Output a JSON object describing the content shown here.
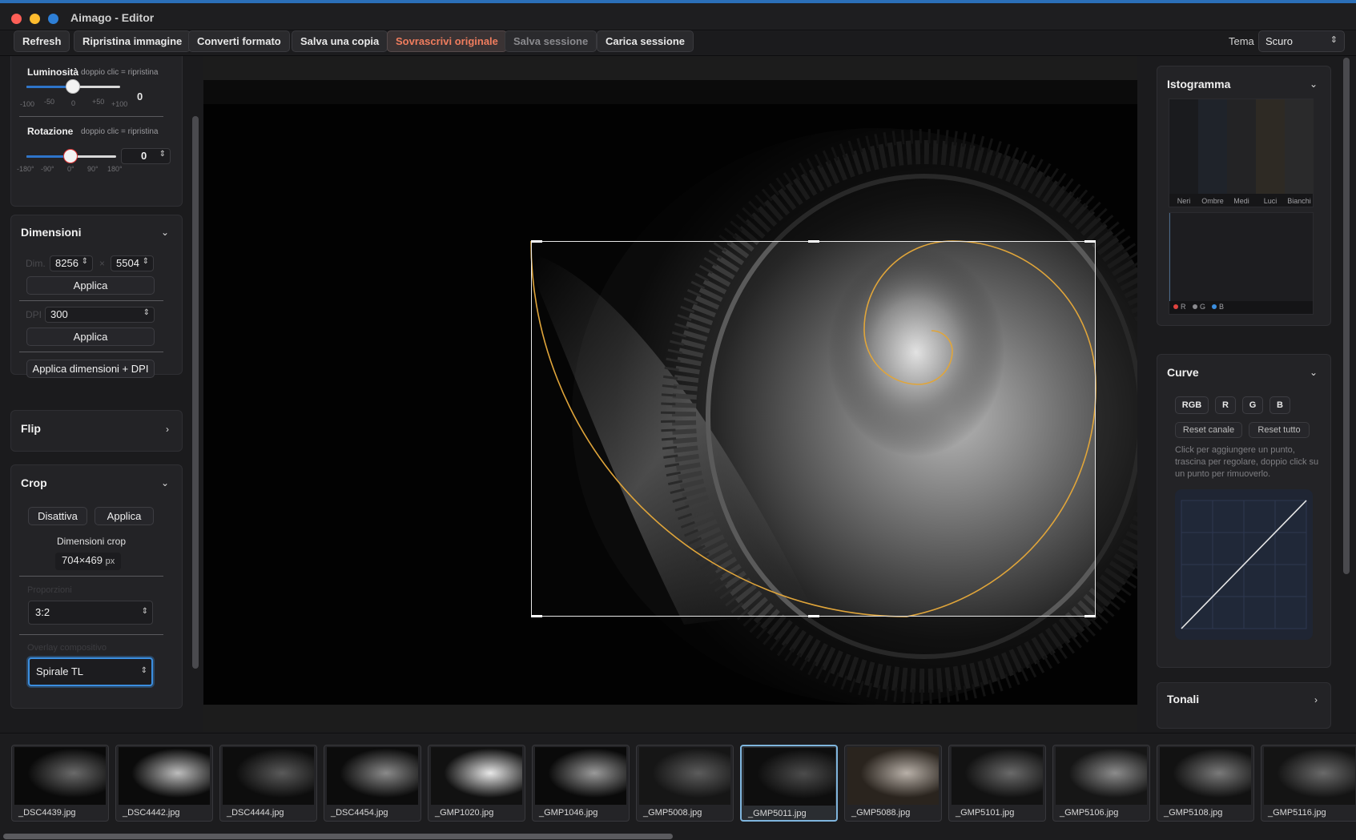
{
  "window": {
    "title": "Aimago - Editor"
  },
  "toolbar": {
    "buttons": [
      "Refresh",
      "Ripristina immagine",
      "Converti formato",
      "Salva una copia",
      "Sovrascrivi originale",
      "Salva sessione",
      "Carica sessione"
    ],
    "theme_label": "Tema",
    "theme_value": "Scuro"
  },
  "left": {
    "brightness": {
      "title": "Luminosità",
      "hint": "doppio clic = ripristina",
      "value": "0",
      "ticks": [
        "-100",
        "-50",
        "0",
        "+50",
        "+100"
      ]
    },
    "rotation": {
      "title": "Rotazione",
      "hint": "doppio clic = ripristina",
      "value": "0",
      "ticks": [
        "-180°",
        "-90°",
        "0°",
        "90°",
        "180°"
      ]
    },
    "dimensions": {
      "title": "Dimensioni",
      "dim_label": "Dim.",
      "width": "8256",
      "sep": "×",
      "height": "5504",
      "apply": "Applica",
      "dpi_label": "DPI",
      "dpi": "300",
      "apply_dpi": "Applica",
      "apply_both": "Applica dimensioni + DPI"
    },
    "flip": {
      "title": "Flip"
    },
    "crop": {
      "title": "Crop",
      "disable": "Disattiva",
      "apply": "Applica",
      "size_label": "Dimensioni crop",
      "size_value": "704×469",
      "size_unit": "px",
      "ratio_label": "Proporzioni",
      "ratio": "3:2",
      "overlay_label": "Overlay compositivo",
      "overlay": "Spirale TL"
    }
  },
  "right": {
    "histogram": {
      "title": "Istogramma",
      "zones": [
        "Neri",
        "Ombre",
        "Medi",
        "Luci",
        "Bianchi"
      ],
      "zone_colors": [
        "#1a1b1e",
        "#1f232a",
        "#232325",
        "#2e2a24",
        "#2a2a2b"
      ],
      "legend": [
        "R",
        "G",
        "B"
      ],
      "legend_colors": [
        "#e0433f",
        "#8a8a8e",
        "#3b8ee0"
      ]
    },
    "curve": {
      "title": "Curve",
      "channels": [
        "RGB",
        "R",
        "G",
        "B"
      ],
      "reset_channel": "Reset canale",
      "reset_all": "Reset tutto",
      "hint": "Click per aggiungere un punto, trascina per regolare, doppio click su un punto per rimuoverlo."
    },
    "tones": {
      "title": "Tonali"
    }
  },
  "filmstrip": {
    "selected": "_GMP5011.jpg",
    "files": [
      "_DSC4439.jpg",
      "_DSC4442.jpg",
      "_DSC4444.jpg",
      "_DSC4454.jpg",
      "_GMP1020.jpg",
      "_GMP1046.jpg",
      "_GMP5008.jpg",
      "_GMP5011.jpg",
      "_GMP5088.jpg",
      "_GMP5101.jpg",
      "_GMP5106.jpg",
      "_GMP5108.jpg",
      "_GMP5116.jpg"
    ]
  },
  "colors": {
    "accent": "#2d74c9",
    "overwrite": "#f07d5e",
    "spiral": "#e0a53a"
  }
}
